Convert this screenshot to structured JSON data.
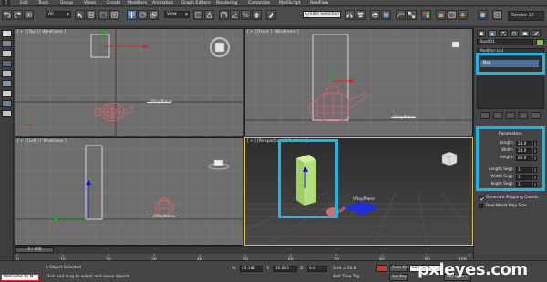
{
  "menu": {
    "app_icon": "3",
    "items": [
      "Edit",
      "Tools",
      "Group",
      "Views",
      "Create",
      "Modifiers",
      "Animation",
      "Graph Editors",
      "Rendering",
      "Customize",
      "MAXScript",
      "RealFlow"
    ]
  },
  "toolbar": {
    "filter_value": "All",
    "coord_value": "View",
    "selection_set_placeholder": "Create Selection Se",
    "render_label": "Render 16"
  },
  "viewports": {
    "top": {
      "label": "[ + ] [Top ] [ Wireframe ]",
      "plane_label": "VRayPlane"
    },
    "front": {
      "label": "[ + ] [Front ] [ Wireframe ]",
      "plane_label": "VRayPlane"
    },
    "left": {
      "label": "[ + ] [Left ] [ Wireframe ]",
      "plane_label": "VRayPlane"
    },
    "perspective": {
      "label": "[ + ] [Perspective ] [ Realistic ]",
      "plane_label": "VRayPlane"
    }
  },
  "command_panel": {
    "object_name": "Box001",
    "object_color": "#8ac23e",
    "modifier_list": "Modifier List",
    "stack_item": "Box",
    "highlight_color": "#19b6e8",
    "rollout_title": "Parameters",
    "params": [
      {
        "label": "Length:",
        "value": "24.0"
      },
      {
        "label": "Width:",
        "value": "24.0"
      },
      {
        "label": "Height:",
        "value": "60.0"
      }
    ],
    "segs": [
      {
        "label": "Length Segs:",
        "value": "1"
      },
      {
        "label": "Width Segs:",
        "value": "1"
      },
      {
        "label": "Height Segs:",
        "value": "1"
      }
    ],
    "checkboxes": [
      {
        "label": "Generate Mapping Coords.",
        "checked": true
      },
      {
        "label": "Real-World Map Size",
        "checked": false
      }
    ]
  },
  "timeline": {
    "slider": "0 / 100",
    "ticks": [
      "0",
      "10",
      "20",
      "30",
      "40",
      "50",
      "60",
      "70",
      "80",
      "90",
      "100"
    ]
  },
  "status": {
    "welcome": "Welcome to M",
    "selection": "1 Object Selected",
    "prompt": "Click and drag to select and move objects",
    "x_label": "X:",
    "x_value": "45.182",
    "y_label": "Y:",
    "y_value": "35.815",
    "z_label": "Z:",
    "z_value": "0.0",
    "grid": "Grid = 10.0",
    "add_time_tag": "Add Time Tag",
    "auto_key": "Auto Key",
    "set_key": "Set Key",
    "selected": "Selected",
    "key_filters": "Key Filters..."
  },
  "watermark": "pxleyes.com"
}
